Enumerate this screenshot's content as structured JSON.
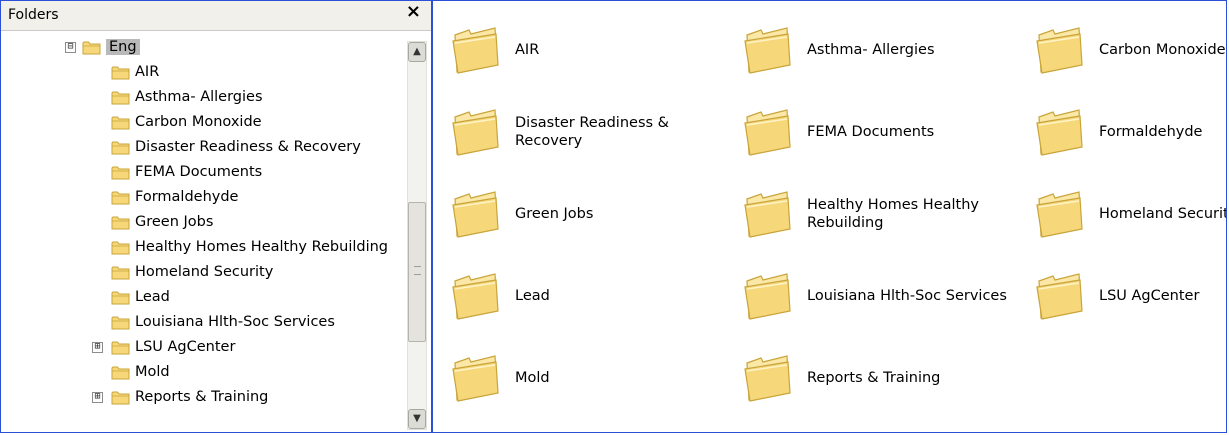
{
  "folders_pane": {
    "title": "Folders",
    "close_glyph": "×",
    "tree": [
      {
        "label": "Eng",
        "level": 0,
        "expander": "⊟",
        "selected": true
      },
      {
        "label": "AIR",
        "level": 1
      },
      {
        "label": "Asthma- Allergies",
        "level": 1
      },
      {
        "label": "Carbon Monoxide",
        "level": 1
      },
      {
        "label": "Disaster Readiness & Recovery",
        "level": 1
      },
      {
        "label": "FEMA Documents",
        "level": 1
      },
      {
        "label": "Formaldehyde",
        "level": 1
      },
      {
        "label": "Green Jobs",
        "level": 1
      },
      {
        "label": "Healthy Homes Healthy Rebuilding",
        "level": 1
      },
      {
        "label": "Homeland Security",
        "level": 1
      },
      {
        "label": "Lead",
        "level": 1
      },
      {
        "label": "Louisiana Hlth-Soc Services",
        "level": 1
      },
      {
        "label": "LSU AgCenter",
        "level": 1,
        "expander": "⊞"
      },
      {
        "label": "Mold",
        "level": 1
      },
      {
        "label": "Reports & Training",
        "level": 1,
        "expander": "⊞"
      }
    ],
    "scrollbar": {
      "up_glyph": "▲",
      "down_glyph": "▼"
    }
  },
  "content_pane": {
    "items": [
      {
        "label": "AIR"
      },
      {
        "label": "Asthma- Allergies"
      },
      {
        "label": "Carbon Monoxide"
      },
      {
        "label": "Disaster Readiness & Recovery"
      },
      {
        "label": "FEMA Documents"
      },
      {
        "label": "Formaldehyde"
      },
      {
        "label": "Green Jobs"
      },
      {
        "label": "Healthy Homes Healthy Rebuilding"
      },
      {
        "label": "Homeland Security"
      },
      {
        "label": "Lead"
      },
      {
        "label": "Louisiana Hlth-Soc Services"
      },
      {
        "label": "LSU AgCenter"
      },
      {
        "label": "Mold"
      },
      {
        "label": "Reports & Training"
      }
    ]
  },
  "colors": {
    "window_border": "#2b4fd6",
    "folder_body": "#f6d77a",
    "folder_edge": "#c9a43a",
    "selection": "#b9b9b9"
  },
  "icons": {
    "folder": "folder-icon",
    "close": "close-icon"
  }
}
